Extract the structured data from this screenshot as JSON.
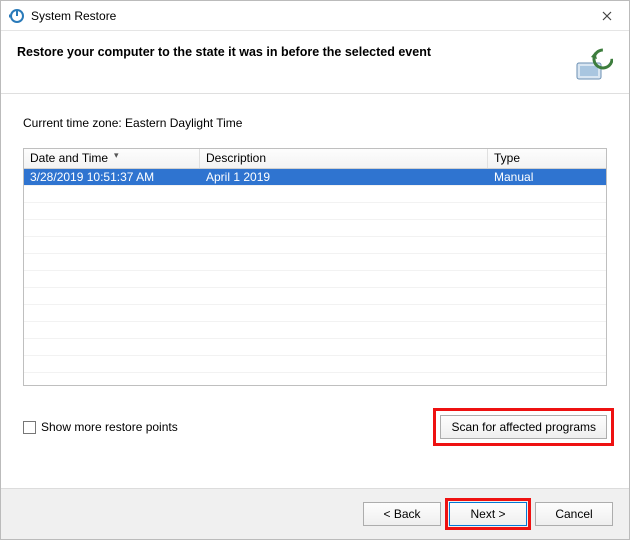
{
  "titlebar": {
    "title": "System Restore"
  },
  "header": {
    "heading": "Restore your computer to the state it was in before the selected event"
  },
  "timezone_line": "Current time zone: Eastern Daylight Time",
  "table": {
    "headers": {
      "date": "Date and Time",
      "description": "Description",
      "type": "Type"
    },
    "rows": [
      {
        "date": "3/28/2019 10:51:37 AM",
        "description": "April 1 2019",
        "type": "Manual",
        "selected": true
      }
    ]
  },
  "show_more": {
    "label": "Show more restore points",
    "checked": false
  },
  "scan_button": "Scan for affected programs",
  "footer": {
    "back": "< Back",
    "next": "Next >",
    "cancel": "Cancel"
  }
}
